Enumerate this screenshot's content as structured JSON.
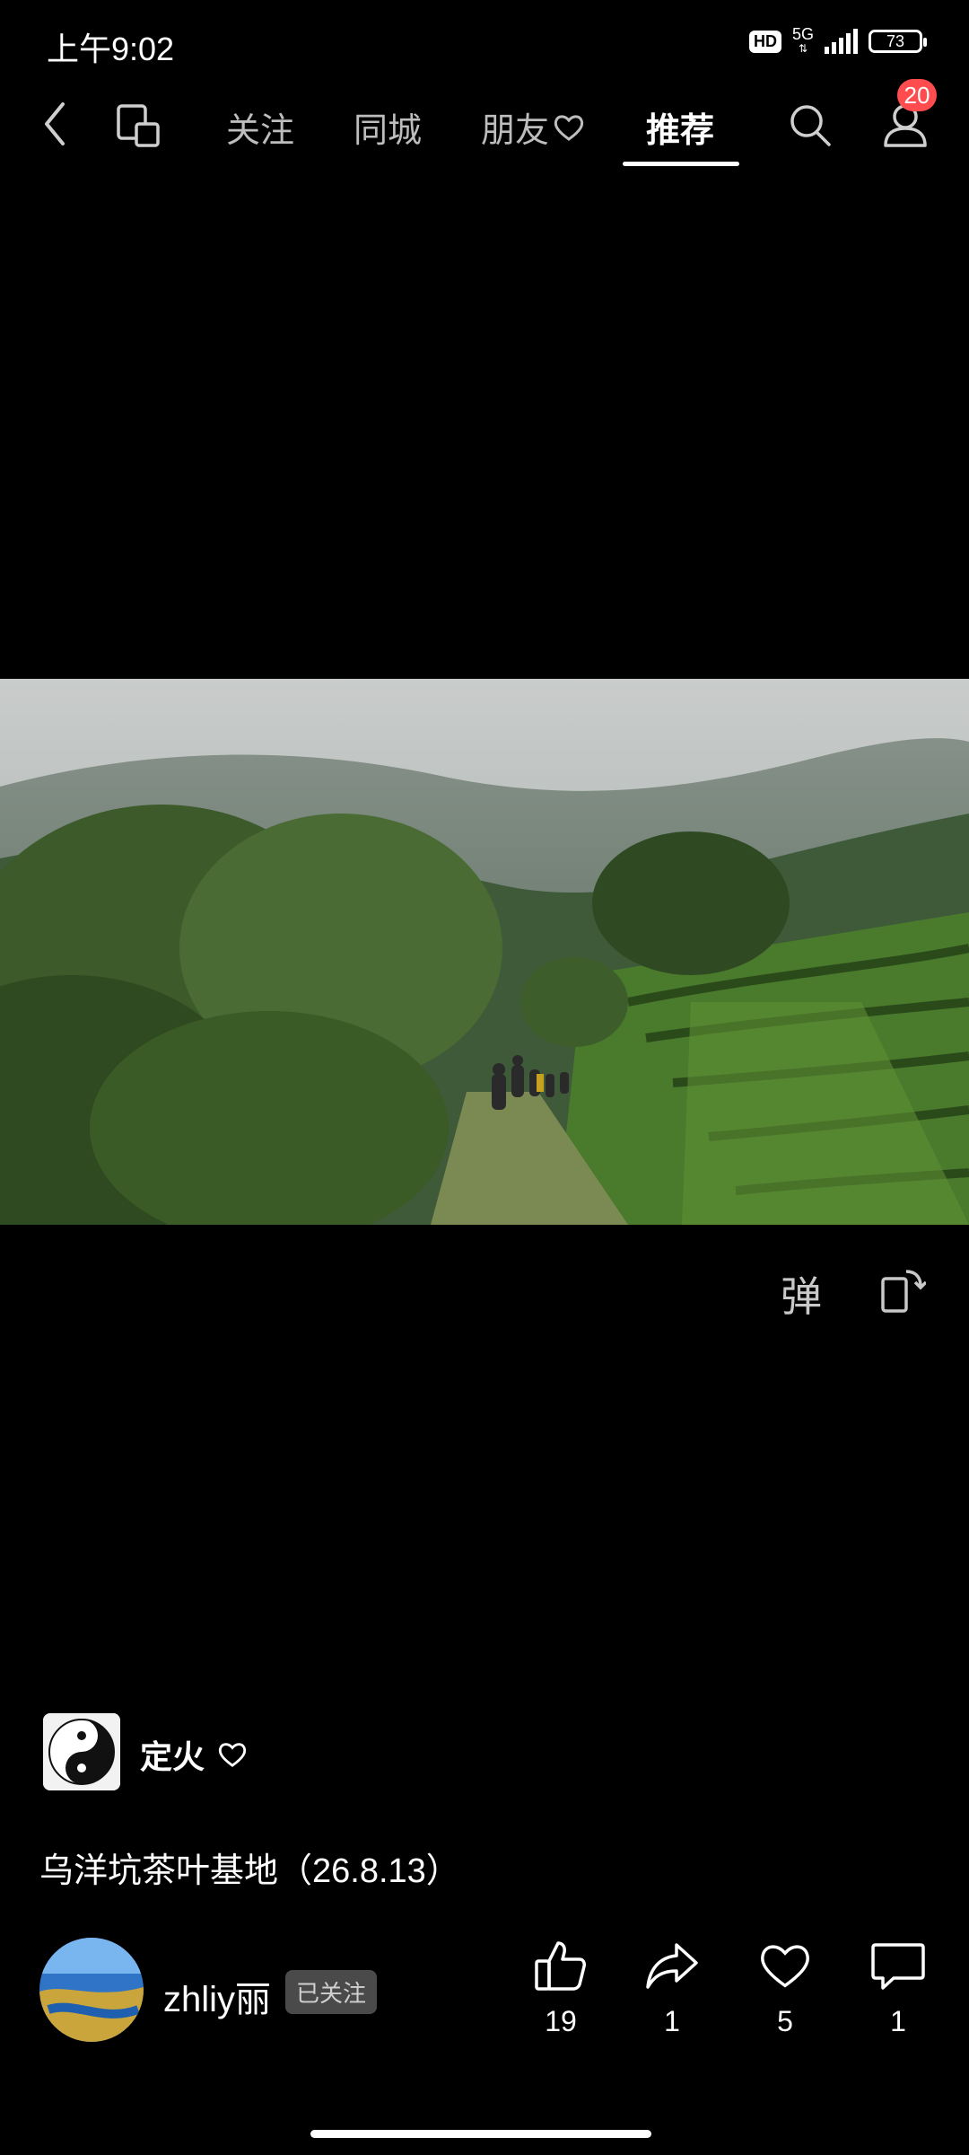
{
  "status": {
    "time": "上午9:02",
    "hd": "HD",
    "network": "5G",
    "battery": "73"
  },
  "nav": {
    "tabs": [
      "关注",
      "同城",
      "朋友",
      "推荐"
    ],
    "active_tab": "推荐",
    "notification_count": "20"
  },
  "video_controls": {
    "danmaku_label": "弹"
  },
  "post": {
    "source_name": "定火",
    "caption": "乌洋坑茶叶基地（26.8.13）"
  },
  "user": {
    "name": "zhliy丽",
    "follow_status": "已关注"
  },
  "actions": {
    "like_count": "19",
    "share_count": "1",
    "favorite_count": "5",
    "comment_count": "1"
  },
  "colors": {
    "background": "#000000",
    "badge": "#ff4d4f",
    "tab_inactive": "#bdbdbd"
  }
}
